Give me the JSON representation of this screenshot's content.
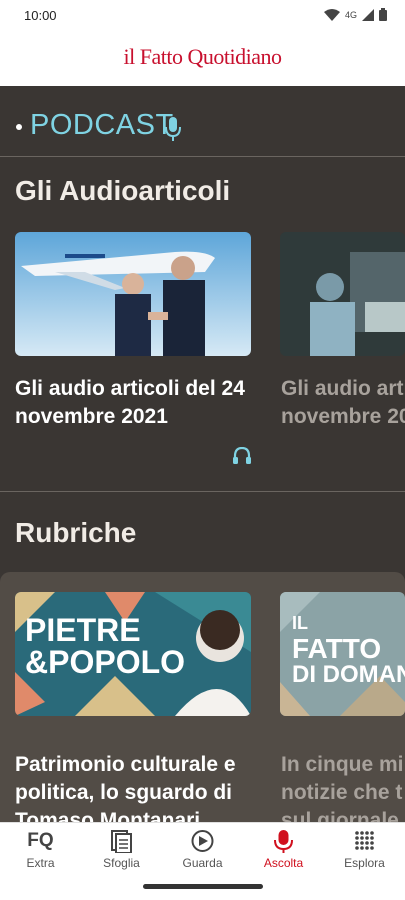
{
  "status_bar": {
    "time": "10:00",
    "network": "4G",
    "icons": [
      "wifi-icon",
      "signal-icon",
      "battery-icon"
    ]
  },
  "header": {
    "logo_text": "il Fatto Quotidiano",
    "brand_color": "#c8102e"
  },
  "podcast": {
    "label": "PODCAST",
    "accent": "#7fd3e3",
    "icon": "microphone-icon"
  },
  "audioarticoli": {
    "heading": "Gli Audioarticoli",
    "cards": [
      {
        "line1": "Gli audio articoli del 24",
        "line2": "novembre 2021",
        "image": "ita-airways-photo",
        "icon": "headphones-icon"
      },
      {
        "line1": "Gli audio arti",
        "line2": "novembre 20",
        "image": "hospital-photo"
      }
    ]
  },
  "rubriche": {
    "heading": "Rubriche",
    "cards": [
      {
        "line1": "PIETRE",
        "line2": "&POPOLO",
        "title_l1": "Patrimonio culturale e",
        "title_l2": "politica, lo sguardo di",
        "title_l3": "Tomaso Montanari"
      },
      {
        "line1": "IL",
        "line2": "FATTO",
        "line3": "DI DOMANI",
        "title_l1": "In cinque mi",
        "title_l2": "notizie che t",
        "title_l3": "sul giornale"
      }
    ]
  },
  "nav": {
    "items": [
      {
        "label": "Extra",
        "icon": "fq-icon"
      },
      {
        "label": "Sfoglia",
        "icon": "pages-icon"
      },
      {
        "label": "Guarda",
        "icon": "play-icon"
      },
      {
        "label": "Ascolta",
        "icon": "microphone-icon",
        "active": true
      },
      {
        "label": "Esplora",
        "icon": "grid-dots-icon"
      }
    ],
    "active_color": "#d0101e"
  }
}
